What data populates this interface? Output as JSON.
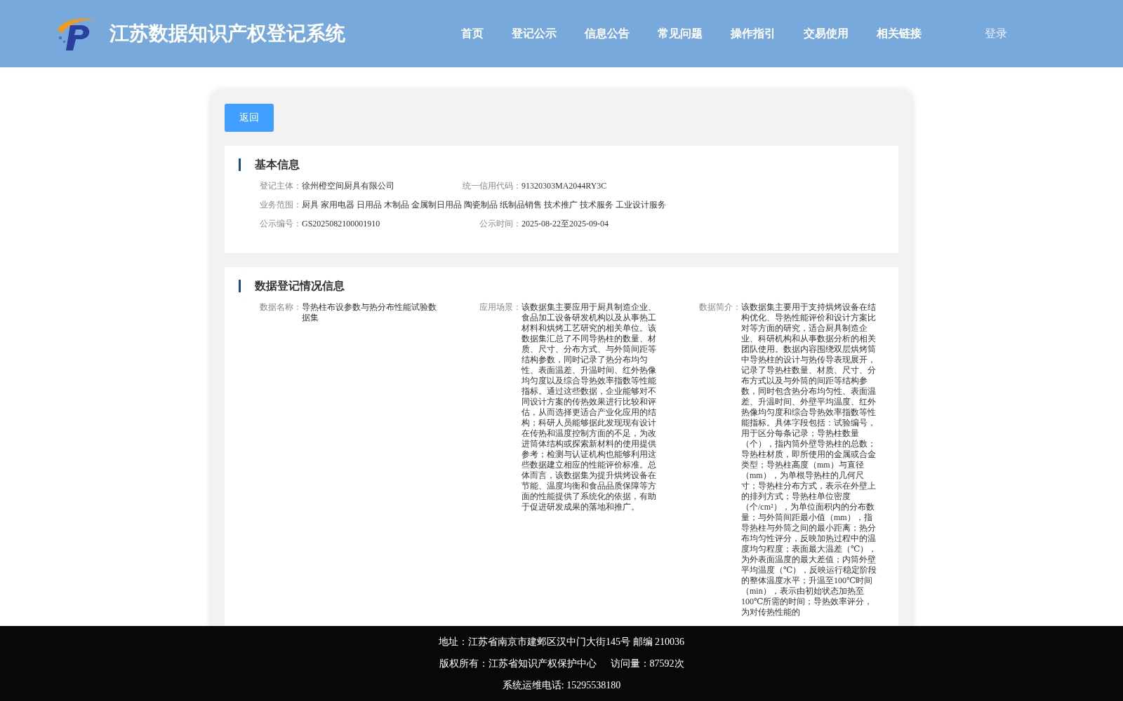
{
  "header": {
    "title": "江苏数据知识产权登记系统",
    "nav": [
      "首页",
      "登记公示",
      "信息公告",
      "常见问题",
      "操作指引",
      "交易使用",
      "相关链接"
    ],
    "login": "登录"
  },
  "back_button": "返回",
  "basic_info": {
    "title": "基本信息",
    "rows": [
      [
        {
          "label": "登记主体：",
          "value": "徐州橙空间厨具有限公司"
        },
        {
          "label": "统一信用代码：",
          "value": "91320303MA2044RY3C"
        }
      ],
      [
        {
          "label": "业务范围：",
          "value": "厨具 家用电器 日用品 木制品 金属制日用品 陶瓷制品 纸制品销售 技术推广 技术服务 工业设计服务"
        }
      ],
      [
        {
          "label": "公示编号：",
          "value": "GS2025082100001910"
        },
        {
          "label": "公示时间：",
          "value": "2025-08-22至2025-09-04"
        }
      ]
    ]
  },
  "data_info": {
    "title": "数据登记情况信息",
    "fields": [
      {
        "label": "数据名称：",
        "value": "导热柱布设参数与热分布性能试验数据集"
      },
      {
        "label": "应用场景：",
        "value": "该数据集主要应用于厨具制造企业、食品加工设备研发机构以及从事热工材料和烘烤工艺研究的相关单位。该数据集汇总了不同导热柱的数量、材质、尺寸、分布方式、与外筒间距等结构参数，同时记录了热分布均匀性、表面温差、升温时间、红外热像均匀度以及综合导热效率指数等性能指标。通过这些数据，企业能够对不同设计方案的传热效果进行比较和评估，从而选择更适合产业化应用的结构；科研人员能够据此发现现有设计在传热和温度控制方面的不足，为改进筒体结构或探索新材料的使用提供参考；检测与认证机构也能够利用这些数据建立相应的性能评价标准。总体而言，该数据集为提升烘烤设备在节能、温度均衡和食品品质保障等方面的性能提供了系统化的依据，有助于促进研发成果的落地和推广。"
      },
      {
        "label": "数据简介：",
        "value": "该数据集主要用于支持烘烤设备在结构优化、导热性能评价和设计方案比对等方面的研究，适合厨具制造企业、科研机构和从事数据分析的相关团队使用。数据内容围绕双层烘烤筒中导热柱的设计与热传导表现展开，记录了导热柱数量、材质、尺寸、分布方式以及与外筒的间距等结构参数，同时包含热分布均匀性、表面温差、升温时间、外壁平均温度、红外热像均匀度和综合导热效率指数等性能指标。具体字段包括：试验编号，用于区分每条记录；导热柱数量（个），指内筒外壁导热柱的总数；导热柱材质，即所使用的金属或合金类型；导热柱高度（mm）与直径（mm），为单根导热柱的几何尺寸；导热柱分布方式，表示在外壁上的排列方式；导热柱单位密度（个/cm²），为单位面积内的分布数量；与外筒间距最小值（mm），指导热柱与外筒之间的最小距离；热分布均匀性评分，反映加热过程中的温度均匀程度；表面最大温差（℃），为外表面温度的最大差值；内筒外壁平均温度（℃），反映运行稳定阶段的整体温度水平；升温至100℃时间（min），表示由初始状态加热至100℃所需的时间；导热效率评分，为对传热性能的"
      }
    ]
  },
  "footer": {
    "lines": [
      [
        "地址：江苏省南京市建邺区汉中门大街145号 邮编 210036"
      ],
      [
        "版权所有：江苏省知识产权保护中心",
        "访问量：87592次"
      ],
      [
        "系统运维电话: 15295538180"
      ]
    ]
  }
}
